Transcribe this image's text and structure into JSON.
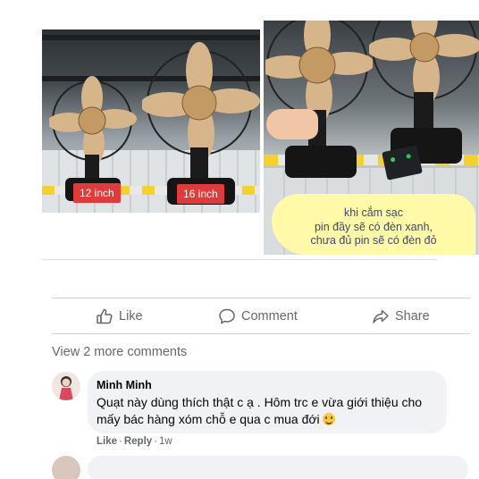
{
  "post": {
    "photo_left": {
      "badges": [
        "12 inch",
        "16 inch"
      ]
    },
    "photo_right": {
      "caption_lines": [
        "khi cắm sạc",
        "pin đầy sẽ có đèn xanh,",
        "chưa đủ pin sẽ có đèn đỏ"
      ]
    }
  },
  "actions": {
    "like_label": "Like",
    "comment_label": "Comment",
    "share_label": "Share"
  },
  "comments": {
    "view_more_label": "View 2 more comments",
    "items": [
      {
        "author": "Minh Minh",
        "text": "Quạt này dùng thích thật c ạ . Hôm trc e vừa giới thiệu cho mấy bác hàng xóm chỗ e qua c mua đới",
        "emoji": "grinning-face",
        "like_label": "Like",
        "reply_label": "Reply",
        "time": "1w"
      }
    ]
  }
}
